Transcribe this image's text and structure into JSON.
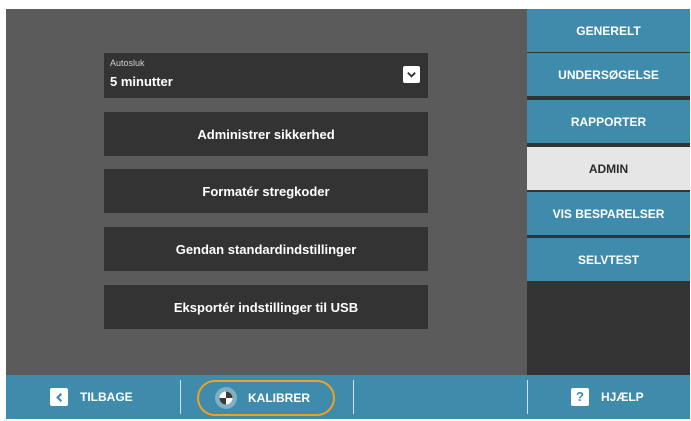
{
  "settings": {
    "autosluk_label": "Autosluk",
    "autosluk_value": "5 minutter"
  },
  "buttons": [
    "Administrer sikkerhed",
    "Formatér stregkoder",
    "Gendan standardindstillinger",
    "Eksportér indstillinger til USB"
  ],
  "sidebar": {
    "tabs": [
      {
        "label": "GENERELT",
        "active": false
      },
      {
        "label": "UNDERSØGELSE",
        "active": false
      },
      {
        "label": "RAPPORTER",
        "active": false
      },
      {
        "label": "ADMIN",
        "active": true
      },
      {
        "label": "VIS BESPARELSER",
        "active": false
      },
      {
        "label": "SELVTEST",
        "active": false
      }
    ]
  },
  "footer": {
    "back_label": "TILBAGE",
    "calibrate_label": "KALIBRER",
    "help_label": "HJÆLP",
    "help_icon_glyph": "?"
  },
  "icons": {
    "dropdown": "chevron-down-icon",
    "back": "chevron-left-icon",
    "calibrate": "calibrate-icon",
    "help": "help-icon"
  },
  "colors": {
    "background": "#5b5b5b",
    "button": "#333333",
    "accent": "#3f8bab",
    "active_tab": "#e6e6e6",
    "highlight": "#f0a21f"
  }
}
